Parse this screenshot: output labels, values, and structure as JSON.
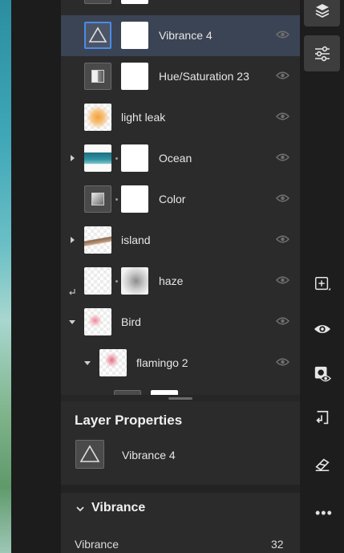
{
  "layers": [
    {
      "name": "Vibrance 4",
      "selected": true,
      "visible": true
    },
    {
      "name": "Hue/Saturation 23",
      "selected": false,
      "visible": true
    },
    {
      "name": "light leak",
      "selected": false,
      "visible": true
    },
    {
      "name": "Ocean",
      "selected": false,
      "visible": true
    },
    {
      "name": "Color",
      "selected": false,
      "visible": true
    },
    {
      "name": "island",
      "selected": false,
      "visible": true
    },
    {
      "name": "haze",
      "selected": false,
      "visible": true
    },
    {
      "name": "Bird",
      "selected": false,
      "visible": true
    },
    {
      "name": "flamingo 2",
      "selected": false,
      "visible": true
    }
  ],
  "properties": {
    "title": "Layer Properties",
    "layer_name": "Vibrance 4",
    "section_title": "Vibrance",
    "slider_label": "Vibrance",
    "slider_value": "32"
  },
  "toolbar": {
    "icons": [
      "layers-icon",
      "adjustments-icon",
      "add-layer-icon",
      "visibility-icon",
      "mask-visibility-icon",
      "clip-layer-icon",
      "eraser-icon",
      "more-icon"
    ]
  },
  "colors": {
    "selection": "#3b4454",
    "selected_border": "#4a8be8",
    "panel": "#2b2b2b"
  }
}
